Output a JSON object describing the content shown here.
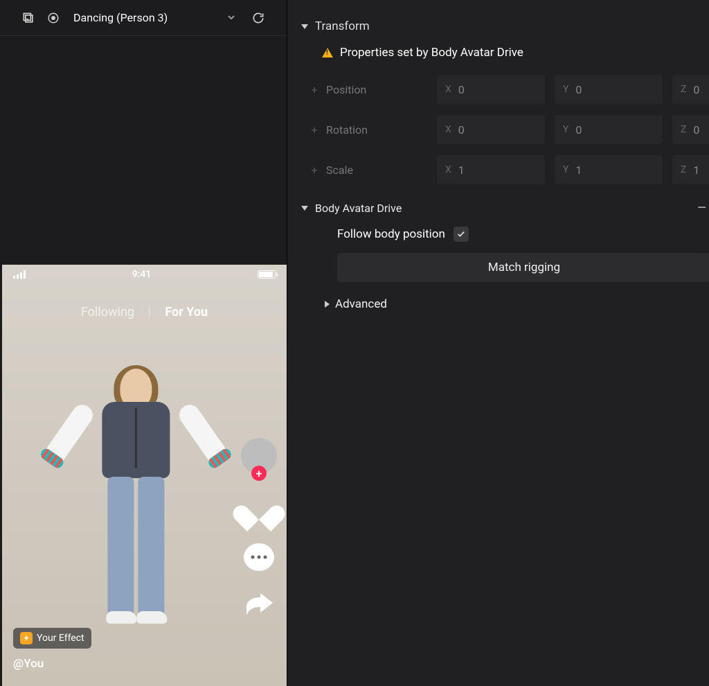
{
  "toolbar": {
    "dropdown_label": "Dancing (Person 3)"
  },
  "preview": {
    "status_time": "9:41",
    "tabs": {
      "following": "Following",
      "foryou": "For You"
    },
    "effect_badge": "Your Effect",
    "username": "@You"
  },
  "inspector": {
    "transform": {
      "title": "Transform",
      "warning": "Properties set by Body Avatar Drive",
      "position": {
        "label": "Position",
        "x": "0",
        "y": "0",
        "z": "0"
      },
      "rotation": {
        "label": "Rotation",
        "x": "0",
        "y": "0",
        "z": "0"
      },
      "scale": {
        "label": "Scale",
        "x": "1",
        "y": "1",
        "z": "1"
      }
    },
    "body_drive": {
      "title": "Body Avatar Drive",
      "follow_label": "Follow body position",
      "follow_checked": true,
      "match_button": "Match rigging"
    },
    "advanced": {
      "title": "Advanced"
    }
  },
  "axes": {
    "x": "X",
    "y": "Y",
    "z": "Z"
  }
}
